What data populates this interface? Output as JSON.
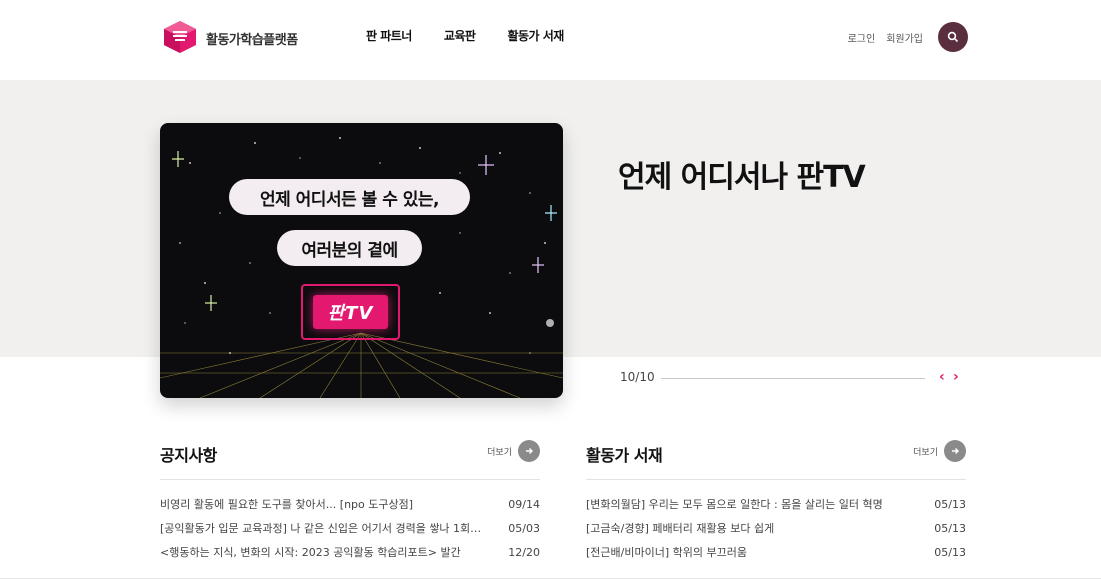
{
  "header": {
    "logo_text": "활동가학습플랫폼",
    "nav": [
      "판 파트너",
      "교육판",
      "활동가 서재"
    ],
    "login": "로그인",
    "signup": "회원가입",
    "search_icon": "search-icon"
  },
  "hero": {
    "card_line1": "언제 어디서든 볼 수 있는,",
    "card_line2": "여러분의 곁에",
    "card_badge": "판TV",
    "title": "언제 어디서나 판TV",
    "slide_counter": "10/10",
    "prev_label": "‹",
    "next_label": "›",
    "accent": "#e2196f"
  },
  "notice": {
    "title": "공지사항",
    "more": "더보기",
    "items": [
      {
        "text": "비영리 활동에 필요한 도구를 찾아서... [npo 도구상점]",
        "date": "09/14"
      },
      {
        "text": "[공익활동가 입문 교육과정] 나 같은 신입은 어기서 경력을 쌓나 1회…",
        "date": "05/03"
      },
      {
        "text": "<행동하는 지식, 변화의 시작: 2023 공익활동 학습리포트> 발간",
        "date": "12/20"
      }
    ]
  },
  "library": {
    "title": "활동가 서재",
    "more": "더보기",
    "items": [
      {
        "text": "[변화의월담] 우리는 모두 몸으로 일한다 : 몸을 살리는 일터 혁명",
        "date": "05/13"
      },
      {
        "text": "[고금숙/경향] 페배터리 재활용 보다 쉽게",
        "date": "05/13"
      },
      {
        "text": "[전근배/비마이너] 학위의 부끄러움",
        "date": "05/13"
      }
    ]
  }
}
